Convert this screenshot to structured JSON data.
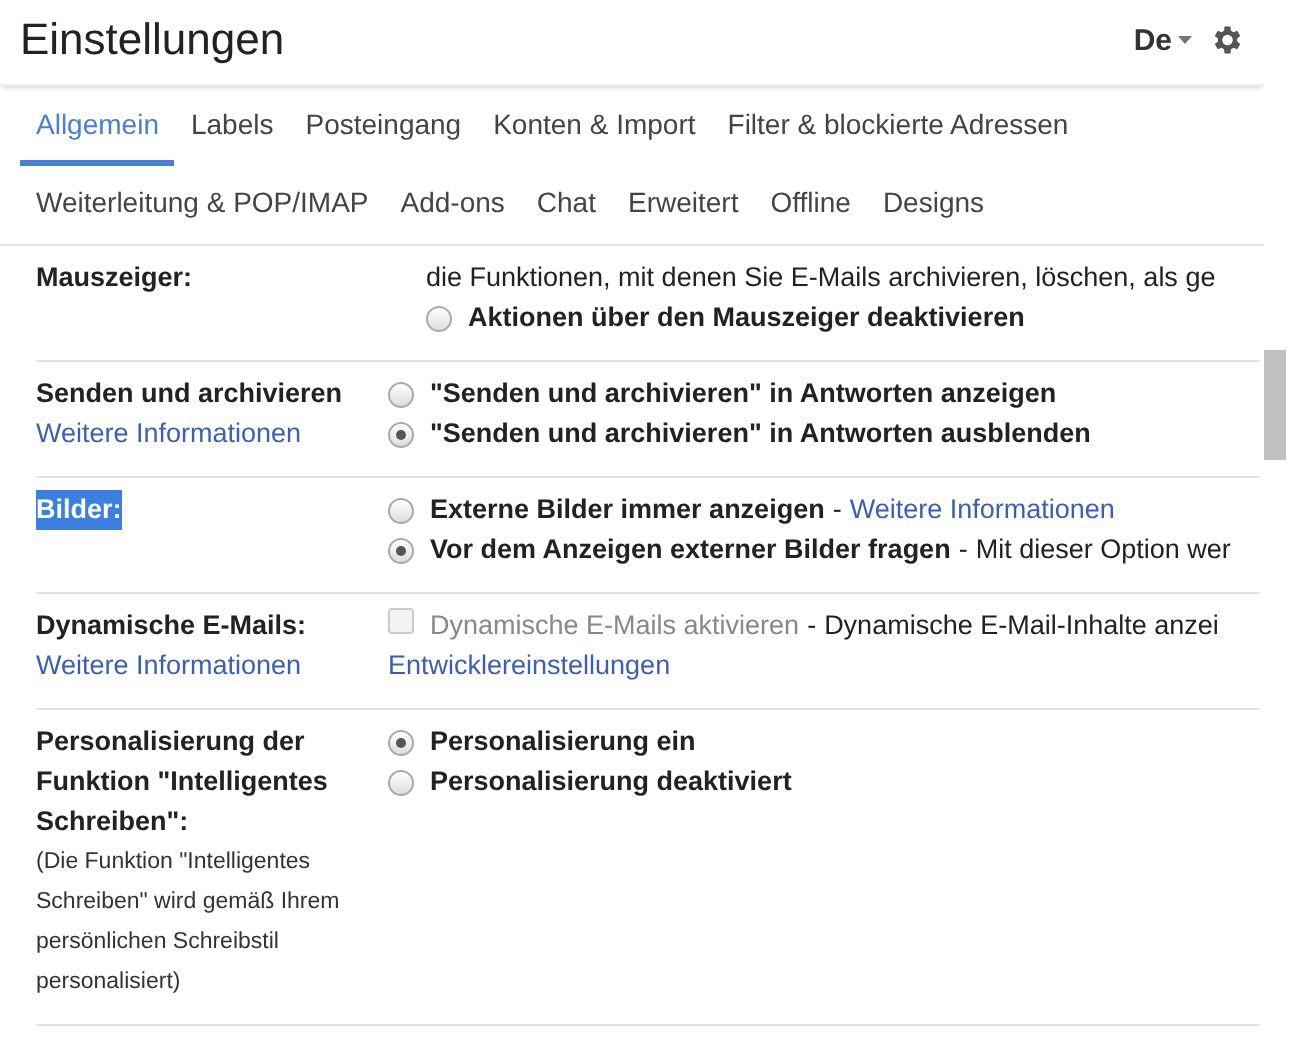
{
  "header": {
    "title": "Einstellungen",
    "language": "De"
  },
  "tab_rows": [
    [
      {
        "label": "Allgemein",
        "selected": true
      },
      {
        "label": "Labels",
        "selected": false
      },
      {
        "label": "Posteingang",
        "selected": false
      },
      {
        "label": "Konten & Import",
        "selected": false
      },
      {
        "label": "Filter & blockierte Adressen",
        "selected": false
      }
    ],
    [
      {
        "label": "Weiterleitung & POP/IMAP",
        "selected": false
      },
      {
        "label": "Add-ons",
        "selected": false
      },
      {
        "label": "Chat",
        "selected": false
      },
      {
        "label": "Erweitert",
        "selected": false
      },
      {
        "label": "Offline",
        "selected": false
      },
      {
        "label": "Designs",
        "selected": false
      }
    ]
  ],
  "sections": [
    {
      "label": "Mauszeiger:",
      "highlighted": false,
      "options": [
        {
          "kind": "text",
          "detail": "die Funktionen, mit denen Sie E-Mails archivieren, löschen, als ge"
        },
        {
          "kind": "radio",
          "selected": false,
          "label": "Aktionen über den Mauszeiger deaktivieren"
        }
      ]
    },
    {
      "label": "Senden und archivieren",
      "highlighted": false,
      "link": "Weitere Informationen",
      "options": [
        {
          "kind": "radio",
          "selected": false,
          "label": "\"Senden und archivieren\" in Antworten anzeigen"
        },
        {
          "kind": "radio",
          "selected": true,
          "label": "\"Senden und archivieren\" in Antworten ausblenden"
        }
      ]
    },
    {
      "label": "Bilder:",
      "highlighted": true,
      "options": [
        {
          "kind": "radio",
          "selected": false,
          "label": "Externe Bilder immer anzeigen",
          "dash": "-",
          "link": "Weitere Informationen"
        },
        {
          "kind": "radio",
          "selected": true,
          "label": "Vor dem Anzeigen externer Bilder fragen",
          "dash": "-",
          "detail": "Mit dieser Option wer"
        }
      ]
    },
    {
      "label": "Dynamische E-Mails:",
      "highlighted": false,
      "link": "Weitere Informationen",
      "options": [
        {
          "kind": "checkbox",
          "checked": false,
          "disabled": true,
          "label": "Dynamische E-Mails aktivieren",
          "dash": "-",
          "detail": "Dynamische E-Mail-Inhalte anzei"
        },
        {
          "kind": "link",
          "link": "Entwicklereinstellungen"
        }
      ]
    },
    {
      "label": "Personalisierung der Funktion \"Intelligentes Schreiben\":",
      "highlighted": false,
      "note": "(Die Funktion \"Intelligentes Schreiben\" wird gemäß Ihrem persönlichen Schreibstil personalisiert)",
      "options": [
        {
          "kind": "radio",
          "selected": true,
          "label": "Personalisierung ein"
        },
        {
          "kind": "radio",
          "selected": false,
          "label": "Personalisierung deaktiviert"
        }
      ]
    }
  ]
}
